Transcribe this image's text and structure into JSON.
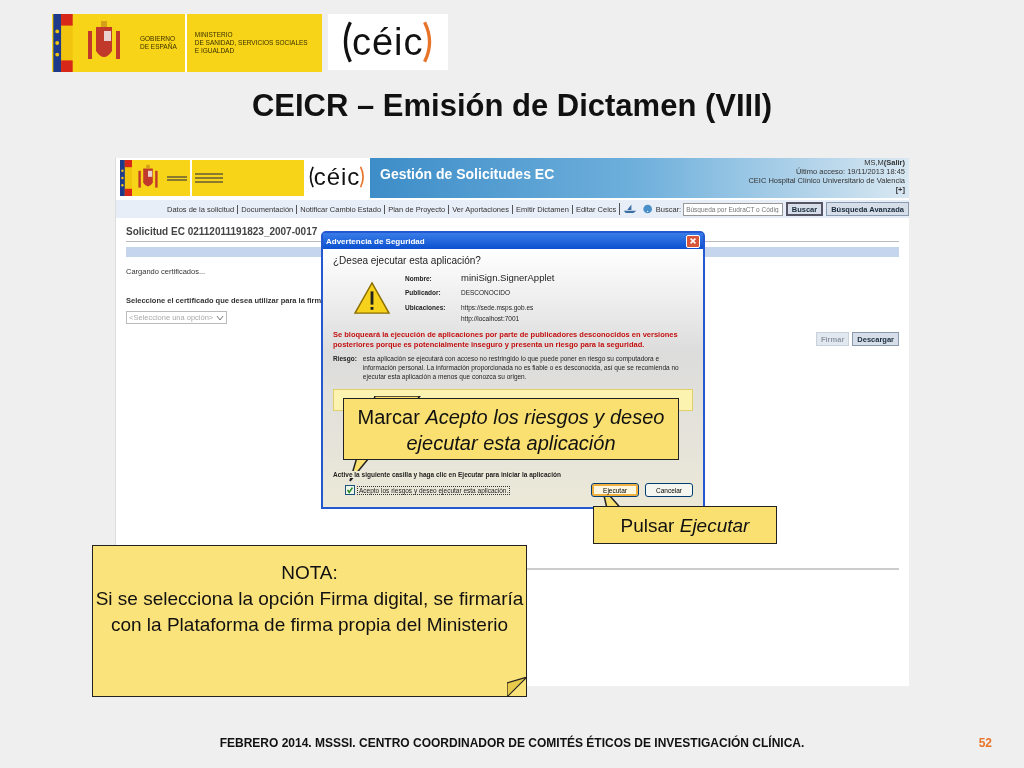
{
  "header_logos": {
    "gov": [
      "GOBIERNO",
      "DE ESPAÑA"
    ],
    "ministry": [
      "MINISTERIO",
      "DE SANIDAD, SERVICIOS SOCIALES",
      "E IGUALDAD"
    ],
    "ceic": "céic"
  },
  "title": "CEICR – Emisión de Dictamen (VIII)",
  "screenshot": {
    "ceic": "céic",
    "app_title": "Gestión de Solicitudes EC",
    "user": "MS,M",
    "logout": "(Salir)",
    "last_access": "Último acceso: 19/11/2013 18:45",
    "organization": "CEIC Hospital Clínico Universitario de Valencia",
    "expand": "[+]",
    "nav": [
      "Datos de la solicitud",
      "Documentación",
      "Notificar Cambio Estado",
      "Plan de Proyecto",
      "Ver Aportaciones",
      "Emitir Dictamen",
      "Editar Ceics"
    ],
    "search_label": "Buscar:",
    "search_placeholder": "Búsqueda por EudraCT o Códig",
    "search_buttons": [
      "Buscar",
      "Búsqueda Avanzada"
    ],
    "heading": "Solicitud EC 02112011191823_2007-0017",
    "loading": "Cargando certificados...",
    "select_prompt": "Seleccione el certificado que desea utilizar para la firm",
    "select_value": "<Seleccione una opción>",
    "actions": [
      {
        "label": "Firmar",
        "disabled": true
      },
      {
        "label": "Descargar",
        "disabled": false
      }
    ]
  },
  "dialog": {
    "title": "Advertencia de Seguridad",
    "question": "¿Desea ejecutar esta aplicación?",
    "fields": [
      {
        "label": "Nombre:",
        "values": [
          "miniSign.SignerApplet"
        ]
      },
      {
        "label": "Publicador:",
        "values": [
          "DESCONOCIDO"
        ]
      },
      {
        "label": "Ubicaciones:",
        "values": [
          "https://sede.msps.gob.es",
          "http://localhost:7001"
        ]
      }
    ],
    "warning": "Se bloqueará la ejecución de aplicaciones por parte de publicadores desconocidos en versiones posteriores porque es potencialmente inseguro y presenta un riesgo para la seguridad.",
    "risk_label": "Riesgo:",
    "risk_text": "esta aplicación se ejecutará con acceso no restringido lo que puede poner en riesgo su computadora e información personal. La información proporcionada no es fiable o es desconocida, así que se recomienda no ejecutar esta aplicación a menos que conozca su origen.",
    "instruction": "Active la siguiente casilla y haga clic en Ejecutar para iniciar la aplicación",
    "checkbox": {
      "label": "Acepto los riesgos y deseo ejecutar esta aplicación.",
      "checked": true
    },
    "buttons": [
      {
        "label": "Ejecutar",
        "default": true
      },
      {
        "label": "Cancelar",
        "default": false
      }
    ]
  },
  "callouts": [
    {
      "text": "Marcar *Acepto los riesgos y deseo ejecutar esta aplicación*"
    },
    {
      "text": "Pulsar *Ejecutar*"
    }
  ],
  "note": {
    "title": "NOTA:",
    "text": "Si se selecciona la opción Firma digital, se firmaría con la Plataforma de firma propia del Ministerio"
  },
  "footer": "FEBRERO 2014. MSSSI. CENTRO COORDINADOR DE COMITÉS ÉTICOS DE INVESTIGACIÓN CLÍNICA.",
  "page_number": "52"
}
